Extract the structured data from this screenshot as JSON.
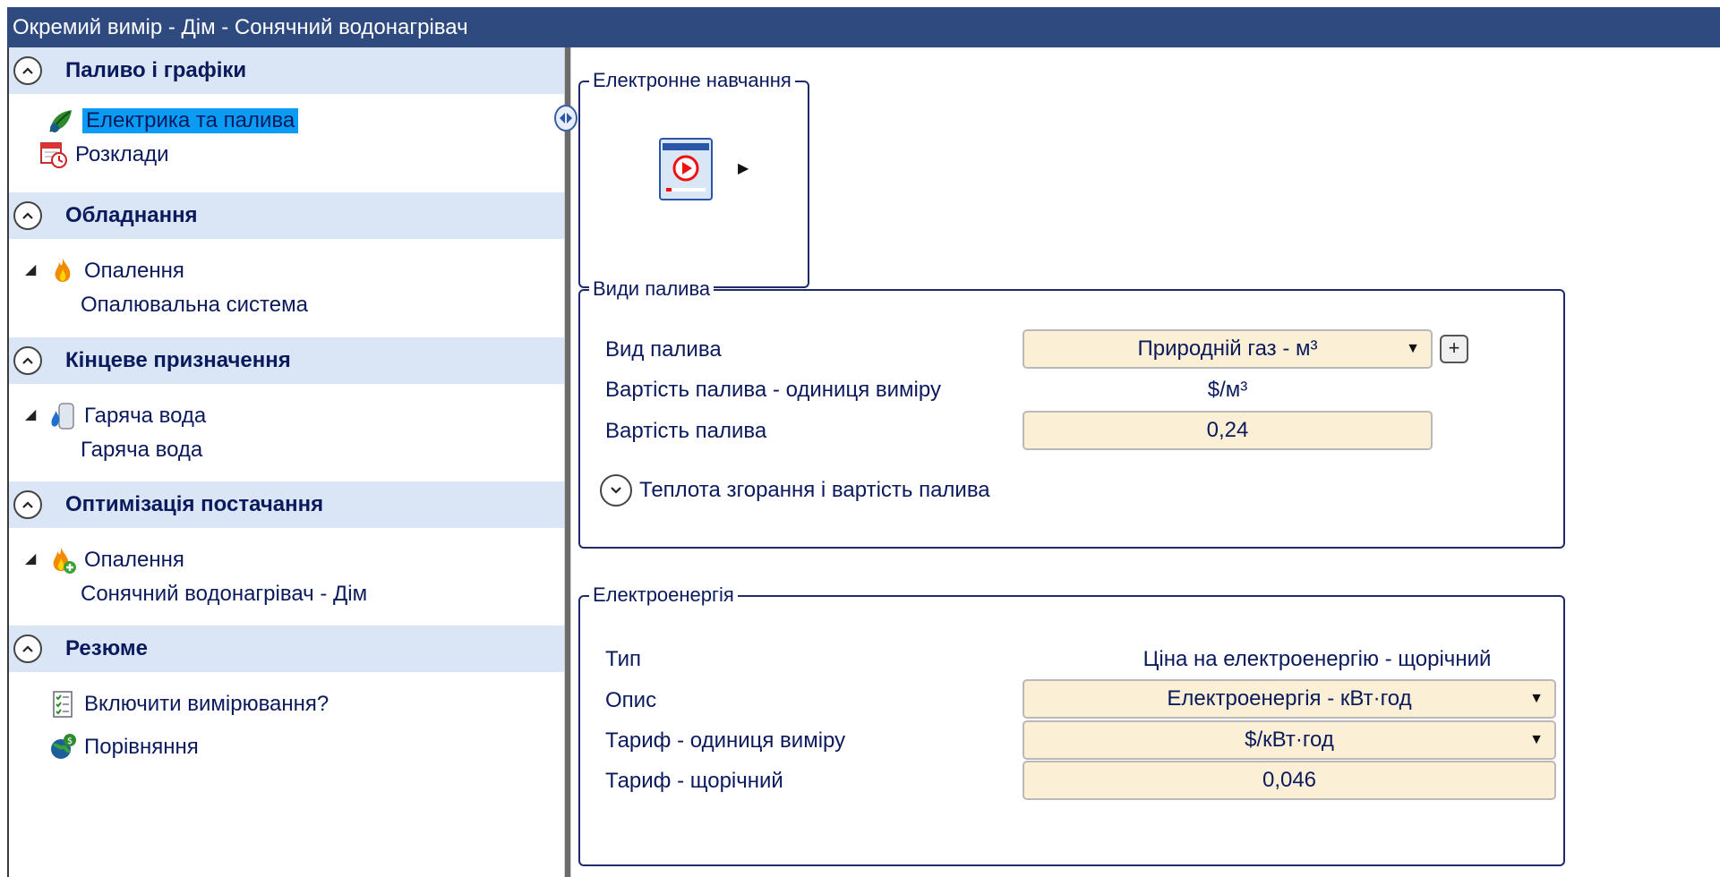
{
  "window": {
    "title": "Окремий вимір - Дім - Сонячний водонагрівач"
  },
  "sidebar": {
    "groups": [
      {
        "title": "Паливо і графіки",
        "items": [
          {
            "label": "Електрика та палива",
            "icon": "fuel-leaf-icon",
            "selected": true
          },
          {
            "label": "Розклади",
            "icon": "calendar-clock-icon"
          }
        ]
      },
      {
        "title": "Обладнання",
        "items": [
          {
            "label": "Опалення",
            "icon": "flame-icon"
          },
          {
            "label": "Опалювальна система"
          }
        ]
      },
      {
        "title": "Кінцеве призначення",
        "items": [
          {
            "label": "Гаряча вода",
            "icon": "water-heater-icon"
          },
          {
            "label": "Гаряча вода"
          }
        ]
      },
      {
        "title": "Оптимізація постачання",
        "items": [
          {
            "label": "Опалення",
            "icon": "flame-add-icon"
          },
          {
            "label": "Сонячний водонагрівач - Дім"
          }
        ]
      },
      {
        "title": "Резюме",
        "items": [
          {
            "label": "Включити вимірювання?",
            "icon": "checklist-icon"
          },
          {
            "label": "Порівняння",
            "icon": "globe-dollar-icon"
          }
        ]
      }
    ]
  },
  "elearning": {
    "legend": "Електронне навчання"
  },
  "fuel_types": {
    "legend": "Види палива",
    "fuel_type_label": "Вид палива",
    "fuel_type_value": "Природній газ - м³",
    "unit_label": "Вартість палива - одиниця виміру",
    "unit_value": "$/м³",
    "cost_label": "Вартість палива",
    "cost_value": "0,24",
    "expander_label": "Теплота згорання і вартість палива"
  },
  "electricity": {
    "legend": "Електроенергія",
    "type_label": "Тип",
    "type_value": "Ціна на електроенергію - щорічний",
    "desc_label": "Опис",
    "desc_value": "Електроенергія - кВт·год",
    "rate_unit_label": "Тариф - одиниця виміру",
    "rate_unit_value": "$/кВт·год",
    "rate_label": "Тариф - щорічний",
    "rate_value": "0,046"
  },
  "colors": {
    "titlebar": "#2e4a7f",
    "group_header": "#dae6f5",
    "selection": "#0a9cf5",
    "field_bg": "#fbefd5",
    "text": "#0b1a5c"
  }
}
